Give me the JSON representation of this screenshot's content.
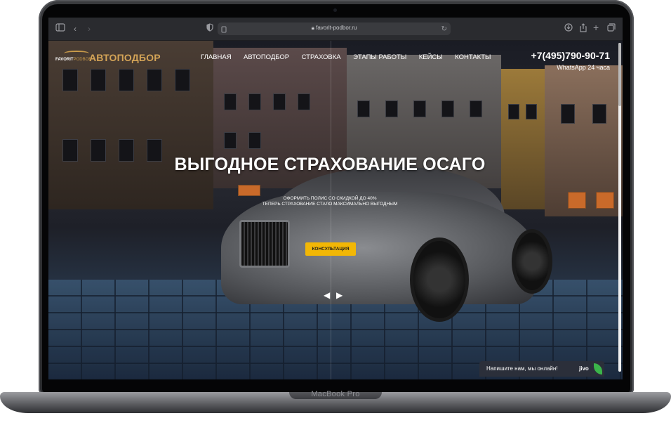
{
  "device": {
    "label": "MacBook Pro"
  },
  "browser": {
    "url": "favorit-podbor.ru",
    "icons": [
      "sidebar-icon",
      "back-icon",
      "forward-icon",
      "shield-icon",
      "page-icon",
      "lock-icon",
      "reload-icon",
      "download-icon",
      "share-icon",
      "new-tab-icon",
      "tabs-icon"
    ]
  },
  "header": {
    "logo_small_1": "FAVORIT",
    "logo_small_2": "PODBOR",
    "logo_big": "АВТОПОДБОР",
    "nav": [
      "ГЛАВНАЯ",
      "АВТОПОДБОР",
      "СТРАХОВКА",
      "ЭТАПЫ РАБОТЫ",
      "КЕЙСЫ",
      "КОНТАКТЫ"
    ],
    "phone": "+7(495)790-90-71",
    "whatsapp": "WhatsApp 24 часа"
  },
  "hero": {
    "title": "ВЫГОДНОЕ СТРАХОВАНИЕ ОСАГО",
    "subtitle_line1": "ОФОРМИТЬ ПОЛИС СО СКИДКОЙ ДО 40%",
    "subtitle_line2": "ТЕПЕРЬ СТРАХОВАНИЕ СТАЛО МАКСИМАЛЬНО ВЫГОДНЫМ",
    "cta_label": "КОНСУЛЬТАЦИЯ",
    "prev_arrow": "◀",
    "next_arrow": "▶"
  },
  "chat": {
    "text": "Напишите нам, мы онлайн!",
    "brand": "jivo"
  },
  "colors": {
    "accent": "#f2b705",
    "logo_gold": "#d4a457",
    "chat_bg": "#2b2f3a"
  }
}
